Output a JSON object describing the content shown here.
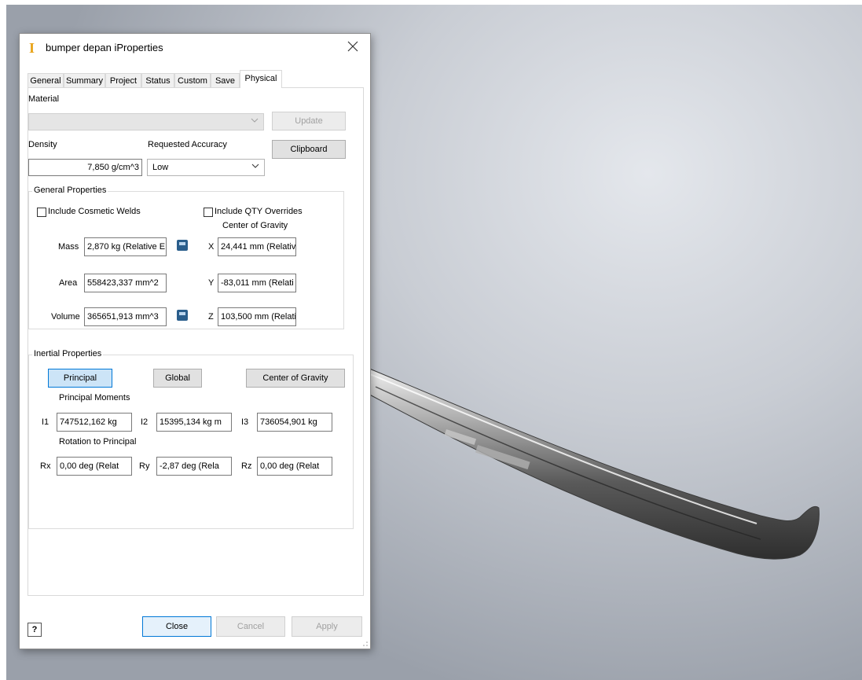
{
  "window": {
    "title": "bumper depan iProperties"
  },
  "tabs": [
    "General",
    "Summary",
    "Project",
    "Status",
    "Custom",
    "Save",
    "Physical"
  ],
  "physical": {
    "material_label": "Material",
    "material_value": "",
    "update_label": "Update",
    "density_label": "Density",
    "density_value": "7,850 g/cm^3",
    "accuracy_label": "Requested Accuracy",
    "accuracy_value": "Low",
    "clipboard_label": "Clipboard",
    "general_properties": {
      "title": "General Properties",
      "include_cosmetic_welds": "Include Cosmetic Welds",
      "include_qty_overrides": "Include QTY Overrides",
      "cog_label": "Center of Gravity",
      "mass_label": "Mass",
      "mass_value": "2,870 kg (Relative E",
      "area_label": "Area",
      "area_value": "558423,337 mm^2",
      "volume_label": "Volume",
      "volume_value": "365651,913 mm^3",
      "x_label": "X",
      "x_value": "24,441 mm (Relativ",
      "y_label": "Y",
      "y_value": "-83,011 mm (Relati",
      "z_label": "Z",
      "z_value": "103,500 mm (Relati"
    },
    "inertial_properties": {
      "title": "Inertial Properties",
      "principal_label": "Principal",
      "global_label": "Global",
      "cog_button_label": "Center of Gravity",
      "principal_moments_label": "Principal Moments",
      "i1_label": "I1",
      "i1_value": "747512,162 kg",
      "i2_label": "I2",
      "i2_value": "15395,134 kg m",
      "i3_label": "I3",
      "i3_value": "736054,901 kg",
      "rotation_label": "Rotation to Principal",
      "rx_label": "Rx",
      "rx_value": "0,00 deg (Relat",
      "ry_label": "Ry",
      "ry_value": "-2,87 deg (Rela",
      "rz_label": "Rz",
      "rz_value": "0,00 deg (Relat"
    }
  },
  "footer": {
    "help_label": "?",
    "close_label": "Close",
    "cancel_label": "Cancel",
    "apply_label": "Apply"
  },
  "colors": {
    "accent": "#0078d7",
    "selected_button": "#cce4f7",
    "calc_icon": "#2a5e8c",
    "app_icon": "#e8a318"
  }
}
